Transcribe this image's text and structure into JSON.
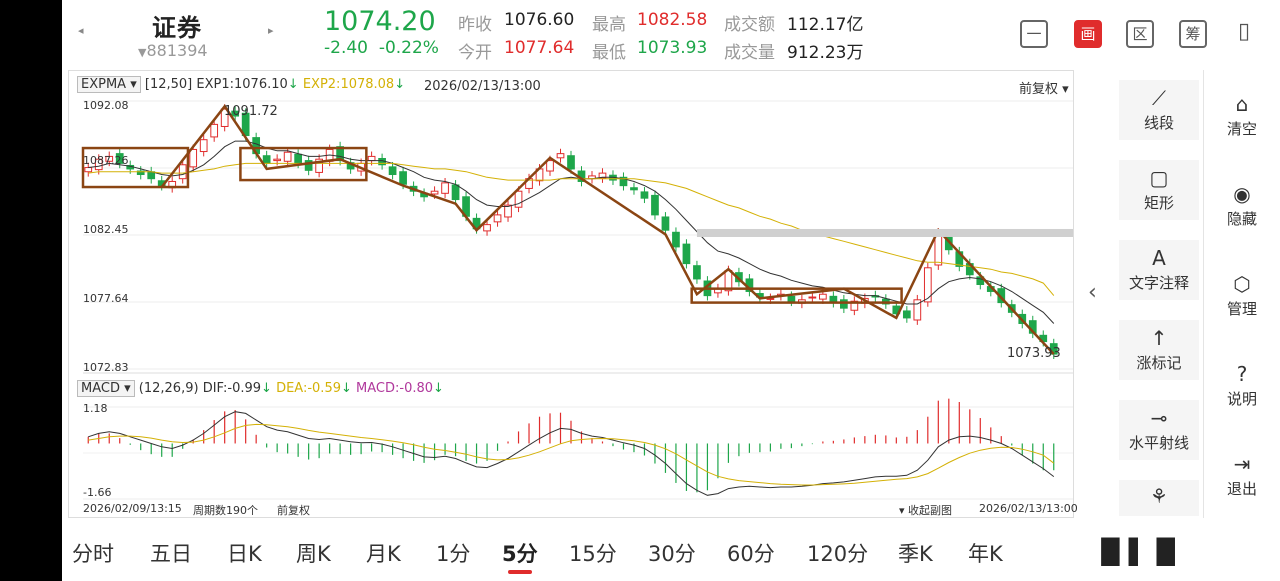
{
  "header": {
    "stock_name": "证券",
    "stock_code": "881394",
    "price": "1074.20",
    "change": "-2.40",
    "change_pct": "-0.22%",
    "prev_close_label": "昨收",
    "prev_close": "1076.60",
    "open_label": "今开",
    "open": "1077.64",
    "high_label": "最高",
    "high": "1082.58",
    "low_label": "最低",
    "low": "1073.93",
    "amount_label": "成交额",
    "amount": "112.17亿",
    "volume_label": "成交量",
    "volume": "912.23万",
    "tools": [
      "一",
      "画",
      "区",
      "筹"
    ]
  },
  "main_chart": {
    "indicator": "EXPMA",
    "params": "[12,50]",
    "exp1": "EXP1:1076.10",
    "exp2": "EXP2:1078.08",
    "datetime": "2026/02/13/13:00",
    "adjust": "前复权",
    "y_ticks": [
      "1092.08",
      "1087.26",
      "1082.45",
      "1077.64",
      "1072.83"
    ],
    "high_mark": "1091.72",
    "low_mark": "1073.93"
  },
  "macd": {
    "name": "MACD",
    "params": "(12,26,9)",
    "dif": "DIF:-0.99",
    "dea": "DEA:-0.59",
    "macd": "MACD:-0.80",
    "y_top": "1.18",
    "y_bottom": "-1.66"
  },
  "footer": {
    "start": "2026/02/09/13:15",
    "periods": "周期数190个",
    "adjust": "前复权",
    "collapse": "收起副图",
    "end": "2026/02/13/13:00"
  },
  "right_panel": [
    {
      "label": "线段",
      "icon": "⟋"
    },
    {
      "label": "矩形",
      "icon": "▢"
    },
    {
      "label": "文字注释",
      "icon": "A"
    },
    {
      "label": "涨标记",
      "icon": "↑"
    },
    {
      "label": "水平射线",
      "icon": "⊸"
    },
    {
      "label": "",
      "icon": "⚘"
    }
  ],
  "side_panel": [
    {
      "label": "清空",
      "icon": "⌂"
    },
    {
      "label": "隐藏",
      "icon": "◉"
    },
    {
      "label": "管理",
      "icon": "⬡"
    },
    {
      "label": "说明",
      "icon": "?"
    },
    {
      "label": "退出",
      "icon": "⇥"
    }
  ],
  "tabs": [
    "分时",
    "五日",
    "日K",
    "周K",
    "月K",
    "1分",
    "5分",
    "15分",
    "30分",
    "60分",
    "120分",
    "季K",
    "年K"
  ],
  "active_tab": "5分",
  "colors": {
    "up": "#e02c2c",
    "down": "#1ea64a",
    "drawing": "#8b4513",
    "ema_fast": "#333333",
    "ema_slow": "#d4b106"
  },
  "chart_data": {
    "type": "candlestick",
    "price_range": [
      1072.83,
      1092.08
    ],
    "closes": [
      1087.3,
      1087.9,
      1088.1,
      1087.6,
      1087.2,
      1086.8,
      1086.5,
      1086.0,
      1086.3,
      1087.5,
      1088.6,
      1089.3,
      1090.4,
      1091.5,
      1091.0,
      1089.6,
      1088.3,
      1087.6,
      1087.9,
      1088.4,
      1087.6,
      1087.1,
      1087.9,
      1088.6,
      1087.8,
      1087.2,
      1087.6,
      1088.1,
      1087.5,
      1086.8,
      1086.1,
      1085.6,
      1085.2,
      1085.6,
      1086.2,
      1085.0,
      1083.8,
      1082.9,
      1083.2,
      1083.9,
      1084.6,
      1085.6,
      1086.5,
      1087.2,
      1087.8,
      1088.3,
      1087.2,
      1086.3,
      1086.7,
      1086.9,
      1086.4,
      1086.0,
      1085.7,
      1085.1,
      1083.9,
      1082.8,
      1081.6,
      1080.4,
      1079.3,
      1078.1,
      1078.6,
      1079.9,
      1079.1,
      1078.4,
      1078.0,
      1077.9,
      1078.2,
      1077.7,
      1077.8,
      1078.0,
      1078.2,
      1077.6,
      1077.2,
      1077.7,
      1077.9,
      1078.0,
      1077.5,
      1076.8,
      1076.5,
      1077.8,
      1080.1,
      1082.6,
      1081.4,
      1080.2,
      1079.6,
      1078.9,
      1078.4,
      1077.6,
      1076.9,
      1076.1,
      1075.4,
      1074.8,
      1073.9
    ],
    "ema1": [
      1087.3,
      1087.4,
      1087.6,
      1087.5,
      1087.4,
      1087.2,
      1087.0,
      1086.8,
      1086.7,
      1086.8,
      1087.1,
      1087.5,
      1088.1,
      1088.8,
      1089.2,
      1089.2,
      1089.0,
      1088.7,
      1088.5,
      1088.5,
      1088.3,
      1088.1,
      1088.1,
      1088.2,
      1088.1,
      1087.9,
      1087.8,
      1087.8,
      1087.8,
      1087.6,
      1087.3,
      1087.0,
      1086.6,
      1086.4,
      1086.3,
      1086.1,
      1085.6,
      1085.0,
      1084.6,
      1084.5,
      1084.5,
      1084.7,
      1085.1,
      1085.5,
      1086.0,
      1086.5,
      1086.6,
      1086.5,
      1086.5,
      1086.6,
      1086.6,
      1086.5,
      1086.3,
      1086.0,
      1085.6,
      1085.0,
      1084.3,
      1083.5,
      1082.7,
      1081.9,
      1081.3,
      1081.1,
      1080.8,
      1080.4,
      1080.0,
      1079.7,
      1079.5,
      1079.2,
      1079.0,
      1078.8,
      1078.7,
      1078.5,
      1078.3,
      1078.2,
      1078.1,
      1078.1,
      1077.9,
      1077.7,
      1077.5,
      1077.5,
      1077.9,
      1078.6,
      1079.1,
      1079.3,
      1079.4,
      1079.3,
      1079.1,
      1078.8,
      1078.4,
      1077.9,
      1077.4,
      1076.9,
      1076.1
    ],
    "ema2": [
      1086.9,
      1087.0,
      1087.0,
      1087.0,
      1087.0,
      1087.0,
      1087.0,
      1086.9,
      1086.9,
      1086.9,
      1087.0,
      1087.1,
      1087.2,
      1087.4,
      1087.5,
      1087.6,
      1087.6,
      1087.6,
      1087.6,
      1087.6,
      1087.6,
      1087.6,
      1087.6,
      1087.6,
      1087.6,
      1087.6,
      1087.6,
      1087.6,
      1087.6,
      1087.6,
      1087.5,
      1087.4,
      1087.3,
      1087.2,
      1087.2,
      1087.1,
      1087.0,
      1086.8,
      1086.6,
      1086.5,
      1086.4,
      1086.4,
      1086.4,
      1086.4,
      1086.4,
      1086.5,
      1086.5,
      1086.5,
      1086.5,
      1086.5,
      1086.5,
      1086.5,
      1086.5,
      1086.4,
      1086.3,
      1086.2,
      1086.0,
      1085.8,
      1085.5,
      1085.2,
      1084.9,
      1084.6,
      1084.4,
      1084.1,
      1083.8,
      1083.6,
      1083.3,
      1083.1,
      1082.8,
      1082.6,
      1082.4,
      1082.2,
      1082.0,
      1081.8,
      1081.6,
      1081.4,
      1081.2,
      1081.0,
      1080.8,
      1080.6,
      1080.5,
      1080.5,
      1080.4,
      1080.3,
      1080.2,
      1080.1,
      1080.0,
      1079.8,
      1079.7,
      1079.5,
      1079.3,
      1079.0,
      1078.1
    ],
    "macd_dif": [
      0.2,
      0.3,
      0.35,
      0.3,
      0.2,
      0.1,
      0.0,
      -0.1,
      -0.15,
      -0.05,
      0.1,
      0.3,
      0.55,
      0.8,
      0.95,
      0.9,
      0.7,
      0.5,
      0.4,
      0.35,
      0.25,
      0.15,
      0.12,
      0.15,
      0.1,
      0.05,
      0.02,
      0.03,
      -0.02,
      -0.1,
      -0.2,
      -0.3,
      -0.4,
      -0.42,
      -0.38,
      -0.45,
      -0.58,
      -0.7,
      -0.72,
      -0.6,
      -0.45,
      -0.25,
      -0.05,
      0.15,
      0.32,
      0.45,
      0.42,
      0.3,
      0.22,
      0.18,
      0.1,
      0.02,
      -0.05,
      -0.15,
      -0.35,
      -0.6,
      -0.9,
      -1.2,
      -1.4,
      -1.55,
      -1.5,
      -1.35,
      -1.3,
      -1.28,
      -1.3,
      -1.32,
      -1.3,
      -1.3,
      -1.28,
      -1.25,
      -1.2,
      -1.18,
      -1.15,
      -1.1,
      -1.05,
      -1.0,
      -0.98,
      -0.98,
      -0.95,
      -0.8,
      -0.5,
      -0.1,
      0.1,
      0.2,
      0.22,
      0.18,
      0.1,
      0.0,
      -0.15,
      -0.35,
      -0.55,
      -0.75,
      -0.99
    ],
    "macd_dea": [
      0.1,
      0.15,
      0.2,
      0.22,
      0.22,
      0.2,
      0.16,
      0.1,
      0.05,
      0.03,
      0.04,
      0.1,
      0.2,
      0.32,
      0.45,
      0.54,
      0.57,
      0.56,
      0.53,
      0.5,
      0.45,
      0.39,
      0.34,
      0.3,
      0.26,
      0.22,
      0.18,
      0.15,
      0.11,
      0.07,
      0.02,
      -0.04,
      -0.11,
      -0.17,
      -0.21,
      -0.26,
      -0.32,
      -0.4,
      -0.46,
      -0.49,
      -0.48,
      -0.43,
      -0.35,
      -0.25,
      -0.13,
      -0.01,
      0.08,
      0.12,
      0.14,
      0.15,
      0.14,
      0.11,
      0.08,
      0.03,
      -0.05,
      -0.16,
      -0.31,
      -0.49,
      -0.67,
      -0.85,
      -0.98,
      -1.06,
      -1.11,
      -1.14,
      -1.17,
      -1.2,
      -1.22,
      -1.23,
      -1.24,
      -1.24,
      -1.23,
      -1.22,
      -1.21,
      -1.19,
      -1.16,
      -1.13,
      -1.1,
      -1.07,
      -1.05,
      -1.0,
      -0.9,
      -0.74,
      -0.57,
      -0.42,
      -0.29,
      -0.2,
      -0.14,
      -0.11,
      -0.12,
      -0.17,
      -0.25,
      -0.35,
      -0.59
    ]
  }
}
